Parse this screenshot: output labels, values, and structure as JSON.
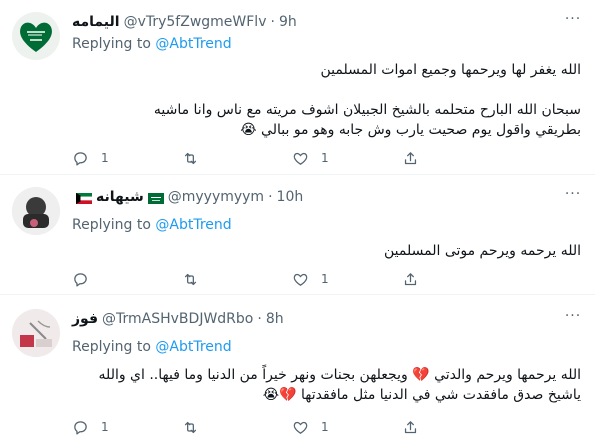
{
  "replying_prefix": "Replying to ",
  "tweets": [
    {
      "name": "اليمامه",
      "handle": "@vTry5fZwgmeWFlv",
      "separator": "·",
      "time": "9h",
      "reply_to": "@AbtTrend",
      "lines": [
        "الله يغفر لها ويرحمها وجميع اموات المسلمين",
        "",
        "سبحان الله البارح متحلمه بالشيخ الجبيلان اشوف مريته مع ناس وانا ماشيه",
        "بطريقي واقول يوم صحيت يارب وش جابه وهو  مو ببالي 😭"
      ],
      "reply_count": "1",
      "retweet_count": "",
      "like_count": "1",
      "more": "···"
    },
    {
      "name": "شيهانه",
      "flags": [
        "kuwait-flag",
        "saudi-flag"
      ],
      "handle": "@myyymyym",
      "separator": "·",
      "time": "10h",
      "reply_to": "@AbtTrend",
      "lines": [
        "الله يرحمه ويرحم موتى المسلمين"
      ],
      "reply_count": "",
      "retweet_count": "",
      "like_count": "1",
      "more": "···"
    },
    {
      "name": "فوز",
      "handle": "@TrmASHvBDJWdRbo",
      "separator": "·",
      "time": "8h",
      "reply_to": "@AbtTrend",
      "lines": [
        "الله يرحمها ويرحم والدتي 💔 ويجعلهن بجنات ونهر خيراً من الدنيا وما فيها.. اي والله",
        "ياشيخ صدق مافقدت شي في الدنيا مثل مافقدتها 💔😭"
      ],
      "reply_count": "1",
      "retweet_count": "",
      "like_count": "1",
      "more": "···"
    }
  ],
  "colors": {
    "accent": "#1d9bf0",
    "secondary_text": "#536471",
    "divider": "#eff3f4",
    "saudi_green": "#006c35"
  },
  "icons": [
    "reply-icon",
    "retweet-icon",
    "like-icon",
    "share-icon",
    "more-icon"
  ]
}
